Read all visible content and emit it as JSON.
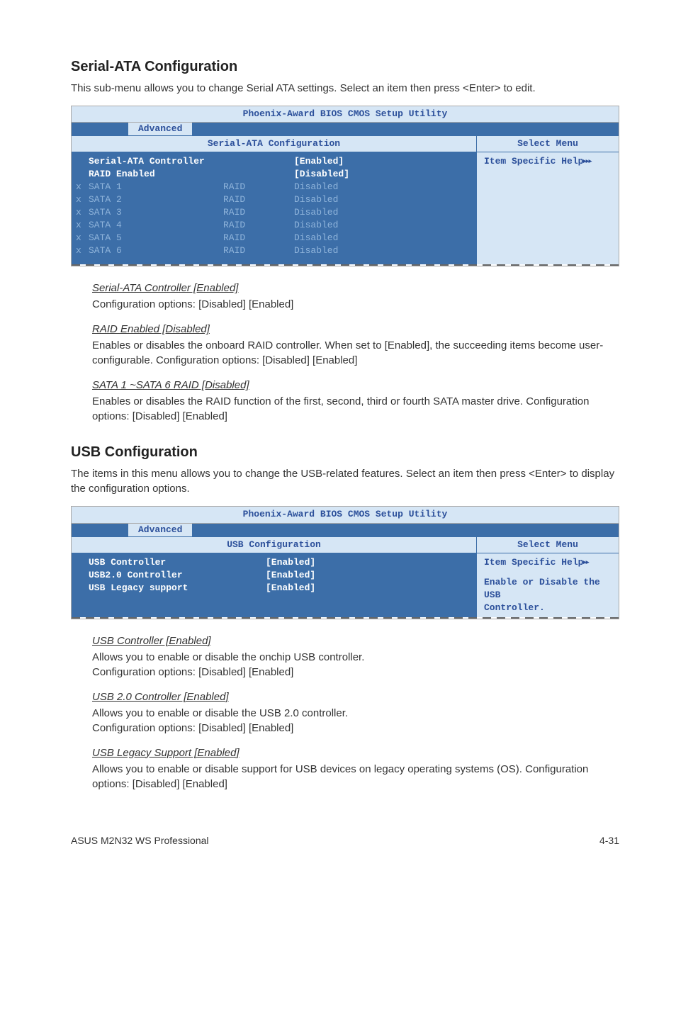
{
  "serial_section": {
    "heading": "Serial-ATA Configuration",
    "intro": "This sub-menu allows you to change Serial ATA settings. Select an item then press <Enter> to edit."
  },
  "bios1": {
    "title": "Phoenix-Award BIOS CMOS Setup Utility",
    "tab": "Advanced",
    "header_left": "Serial-ATA Configuration",
    "header_right": "Select Menu",
    "help_text": "Item Specific Help",
    "rows_main": [
      {
        "label": "Serial-ATA Controller",
        "mid": "",
        "value": "[Enabled]"
      },
      {
        "label": "RAID Enabled",
        "mid": "",
        "value": "[Disabled]"
      }
    ],
    "rows_dim": [
      {
        "x": "x",
        "label": "SATA 1",
        "mid": "RAID",
        "value": "Disabled"
      },
      {
        "x": "x",
        "label": "SATA 2",
        "mid": "RAID",
        "value": "Disabled"
      },
      {
        "x": "x",
        "label": "SATA 3",
        "mid": "RAID",
        "value": "Disabled"
      },
      {
        "x": "x",
        "label": "SATA 4",
        "mid": "RAID",
        "value": "Disabled"
      },
      {
        "x": "x",
        "label": "SATA 5",
        "mid": "RAID",
        "value": "Disabled"
      },
      {
        "x": "x",
        "label": "SATA 6",
        "mid": "RAID",
        "value": "Disabled"
      }
    ]
  },
  "opts1": [
    {
      "head": "Serial-ATA Controller [Enabled]",
      "text": "Configuration options: [Disabled] [Enabled]"
    },
    {
      "head": "RAID Enabled [Disabled]",
      "text": "Enables or disables the onboard RAID controller. When set to [Enabled], the succeeding items become user-configurable. Configuration options: [Disabled] [Enabled]"
    },
    {
      "head": "SATA 1 ~SATA 6 RAID [Disabled]",
      "text": "Enables or disables the RAID function of the first, second, third or fourth SATA master drive. Configuration options: [Disabled] [Enabled]"
    }
  ],
  "usb_section": {
    "heading": "USB Configuration",
    "intro": "The items in this menu allows you to change the USB-related features. Select an item then press <Enter> to display the configuration options."
  },
  "bios2": {
    "title": "Phoenix-Award BIOS CMOS Setup Utility",
    "tab": "Advanced",
    "header_left": "USB Configuration",
    "header_right": "Select Menu",
    "help_text": "Item Specific Help",
    "help_extra1": "Enable or Disable the USB",
    "help_extra2": "Controller.",
    "rows": [
      {
        "label": "USB Controller",
        "value": "[Enabled]"
      },
      {
        "label": "USB2.0 Controller",
        "value": "[Enabled]"
      },
      {
        "label": "USB Legacy support",
        "value": "[Enabled]"
      }
    ]
  },
  "opts2": [
    {
      "head": "USB Controller [Enabled]",
      "text": "Allows you to enable or disable the onchip USB controller.\nConfiguration options: [Disabled] [Enabled]"
    },
    {
      "head": "USB 2.0 Controller [Enabled]",
      "text": "Allows you to enable or disable the USB 2.0 controller.\nConfiguration options: [Disabled] [Enabled]"
    },
    {
      "head": "USB Legacy Support [Enabled]",
      "text": "Allows you to enable or disable support for USB devices on legacy operating systems (OS). Configuration options: [Disabled] [Enabled]"
    }
  ],
  "footer": {
    "left": "ASUS M2N32 WS Professional",
    "right": "4-31"
  }
}
